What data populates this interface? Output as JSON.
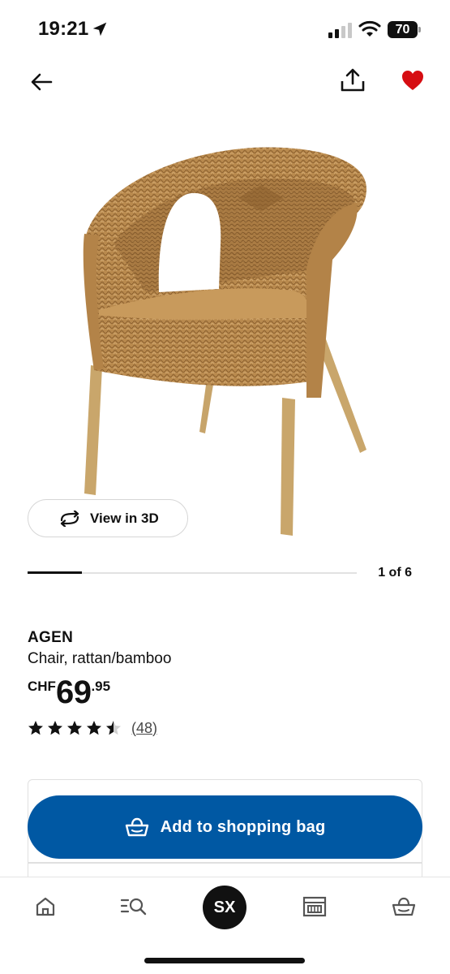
{
  "status_bar": {
    "time": "19:21",
    "battery": "70",
    "location_icon": "location-arrow-icon",
    "signal_icon": "cell-signal-icon",
    "wifi_icon": "wifi-icon"
  },
  "top_nav": {
    "back_icon": "arrow-left-icon",
    "share_icon": "share-icon",
    "favourite_icon": "heart-icon",
    "favourite_color": "#d60d12"
  },
  "product": {
    "view3d_label": "View in 3D",
    "view3d_icon": "rotate-3d-icon",
    "carousel_position": "1 of 6",
    "carousel_progress": 0.166,
    "name": "AGEN",
    "description": "Chair, rattan/bamboo",
    "price_currency": "CHF",
    "price_main": "69",
    "price_decimals": ".95",
    "rating_stars": 4.5,
    "rating_count": "(48)"
  },
  "actions": {
    "add_to_bag_label": "Add to shopping bag",
    "add_to_bag_icon": "basket-icon",
    "accent": "#0058a3"
  },
  "tab_bar": {
    "home_icon": "home-icon",
    "search_icon": "search-list-icon",
    "profile_initials": "SX",
    "store_icon": "store-icon",
    "basket_icon": "basket-icon"
  }
}
